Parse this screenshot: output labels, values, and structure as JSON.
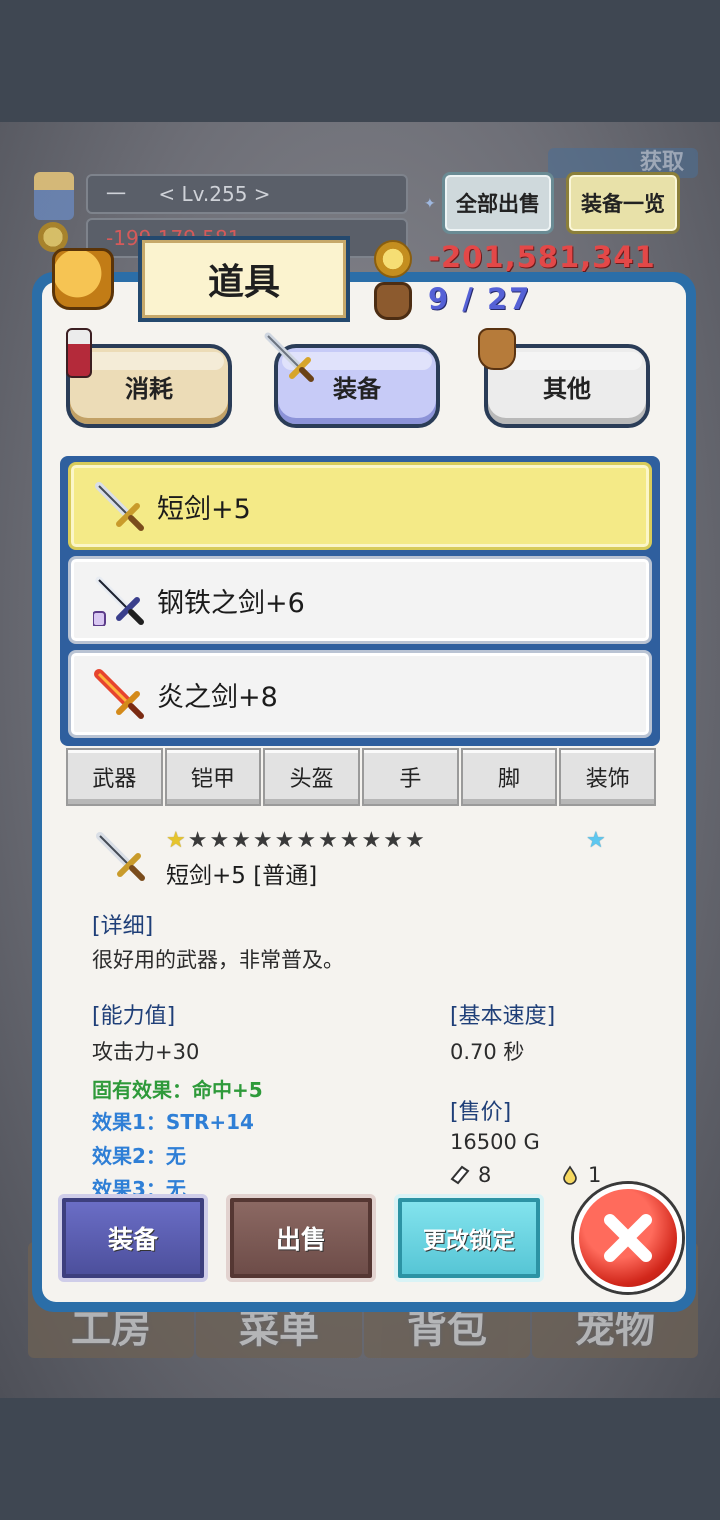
{
  "hud": {
    "level_class": "一",
    "level": "< Lv.255 >",
    "gold_bg": "-199,179,581",
    "corner_tag": "获取",
    "sell_all": "全部出售",
    "equip_list": "装备一览"
  },
  "panel": {
    "title": "道具",
    "gold": "-201,581,341",
    "bag": "9 / 27"
  },
  "tabs": {
    "consume": "消耗",
    "equip": "装备",
    "other": "其他"
  },
  "items": [
    {
      "name": "短剑+5",
      "selected": true
    },
    {
      "name": "钢铁之剑+6",
      "selected": false
    },
    {
      "name": "炎之剑+8",
      "selected": false
    }
  ],
  "slots": [
    "武器",
    "铠甲",
    "头盔",
    "手",
    "脚",
    "装饰"
  ],
  "detail": {
    "name": "短剑+5 [普通]",
    "stars_gold": "★",
    "stars_gray": "★★★★★★★★★★★",
    "blue_star": "★",
    "detail_header": "[详细]",
    "description": "很好用的武器，非常普及。",
    "stats_header": "[能力值]",
    "attack": "攻击力+30",
    "fixed_effect": "固有效果：命中+5",
    "effect1": "效果1：STR+14",
    "effect2": "效果2：无",
    "effect3": "效果3：无",
    "speed_header": "[基本速度]",
    "speed": "0.70 秒",
    "price_header": "[售价]",
    "price": "16500 G",
    "whetstone_count": "8",
    "drop_count": "1"
  },
  "actions": {
    "equip": "装备",
    "sell": "出售",
    "lock": "更改锁定"
  },
  "bg_nav": [
    "工房",
    "菜单",
    "背包",
    "宠物"
  ],
  "colors": {
    "panel_border": "#2b6ea8",
    "gold_text": "#e34848",
    "bag_text": "#5561d6",
    "selected_row": "#f4ea87",
    "green_effect": "#2e9a3a",
    "blue_effect": "#2f7fd6"
  }
}
